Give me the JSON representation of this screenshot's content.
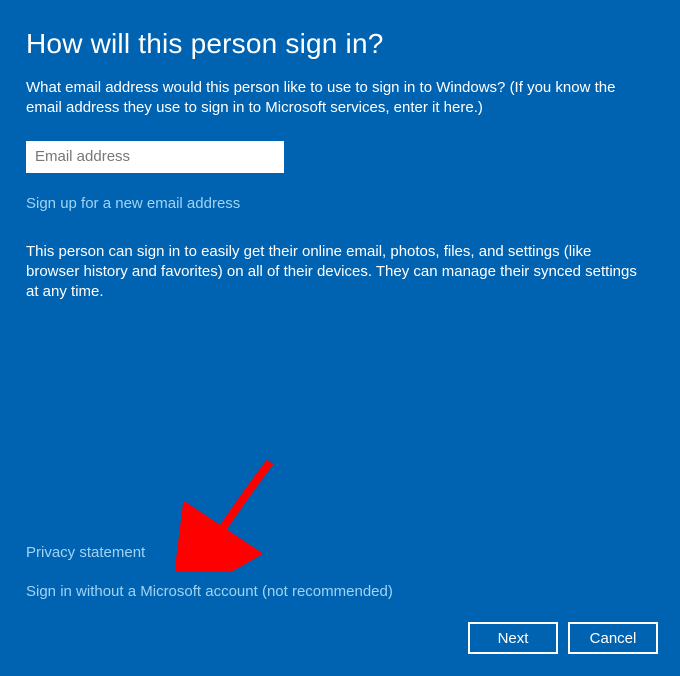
{
  "dialog": {
    "title": "How will this person sign in?",
    "subtitle": "What email address would this person like to use to sign in to Windows? (If you know the email address they use to sign in to Microsoft services, enter it here.)",
    "email_placeholder": "Email address",
    "email_value": "",
    "signup_link_label": "Sign up for a new email address",
    "info_text": "This person can sign in to easily get their online email, photos, files, and settings (like browser history and favorites) on all of their devices. They can manage their synced settings at any time.",
    "privacy_link_label": "Privacy statement",
    "no_ms_account_label": "Sign in without a Microsoft account (not recommended)"
  },
  "buttons": {
    "next": "Next",
    "cancel": "Cancel"
  },
  "colors": {
    "background": "#0063b1",
    "link": "#9fd3f5",
    "text": "#ffffff",
    "arrow": "#ff0000"
  }
}
